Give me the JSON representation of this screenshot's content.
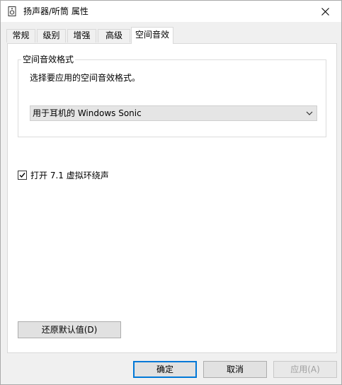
{
  "window": {
    "title": "扬声器/听筒 属性"
  },
  "tabs": [
    {
      "label": "常规"
    },
    {
      "label": "级别"
    },
    {
      "label": "增强"
    },
    {
      "label": "高级"
    },
    {
      "label": "空间音效",
      "active": true
    }
  ],
  "spatial": {
    "group_title": "空间音效格式",
    "description": "选择要应用的空间音效格式。",
    "selected_format": "用于耳机的 Windows Sonic",
    "virtual_surround_label": "打开 7.1 虚拟环绕声",
    "virtual_surround_checked": true,
    "restore_label": "还原默认值(D)"
  },
  "buttons": {
    "ok": "确定",
    "cancel": "取消",
    "apply": "应用(A)"
  },
  "colors": {
    "accent": "#0078d7",
    "window_bg": "#f0f0f0",
    "panel_bg": "#ffffff"
  }
}
